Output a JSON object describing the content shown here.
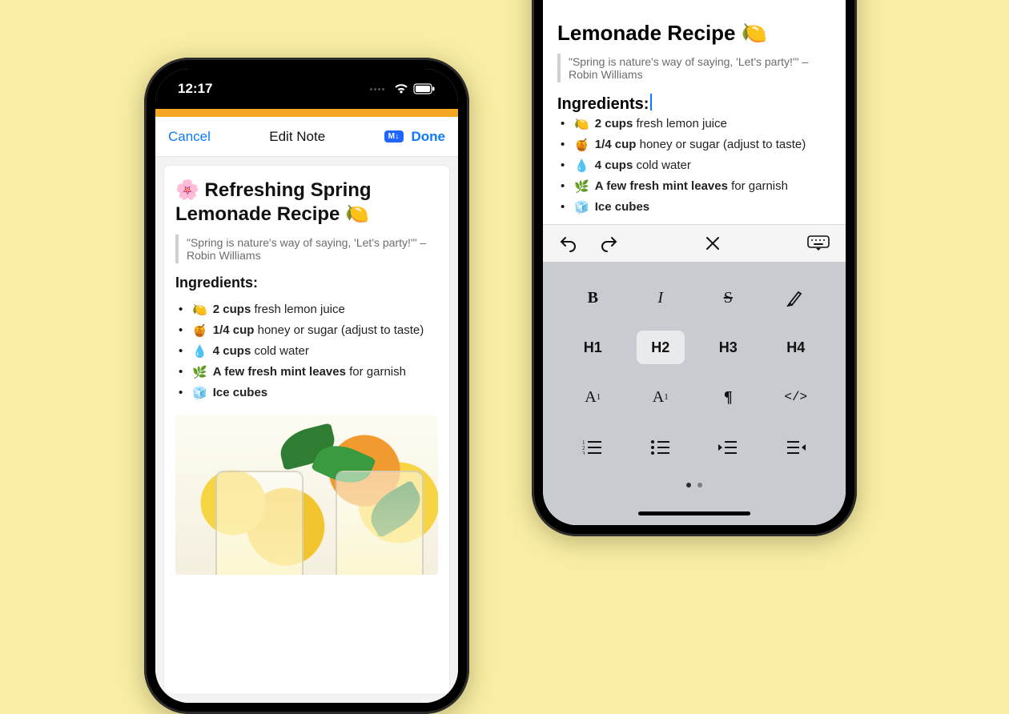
{
  "statusbar": {
    "time": "12:17"
  },
  "nav": {
    "cancel": "Cancel",
    "title": "Edit Note",
    "badge": "M↓",
    "done": "Done"
  },
  "note": {
    "title": "🌸 Refreshing Spring Lemonade Recipe 🍋",
    "quote": "\"Spring is nature's way of saying, 'Let's party!'\" – Robin Williams",
    "ingredients_heading": "Ingredients:",
    "ingredients": [
      {
        "emoji": "🍋",
        "qty": "2 cups",
        "rest": " fresh lemon juice"
      },
      {
        "emoji": "🍯",
        "qty": "1/4 cup",
        "rest": " honey or sugar (adjust to taste)"
      },
      {
        "emoji": "💧",
        "qty": "4 cups",
        "rest": " cold water"
      },
      {
        "emoji": "🌿",
        "qty": "A few fresh mint leaves",
        "rest": " for garnish"
      },
      {
        "emoji": "🧊",
        "qty": "Ice cubes",
        "rest": ""
      }
    ]
  },
  "note2": {
    "title": "Lemonade Recipe 🍋",
    "quote": "\"Spring is nature's way of saying, 'Let's party!'\" – Robin Williams",
    "ingredients_heading": "Ingredients:"
  },
  "format": {
    "headings": [
      "H1",
      "H2",
      "H3",
      "H4"
    ],
    "selected_heading": "H2"
  }
}
